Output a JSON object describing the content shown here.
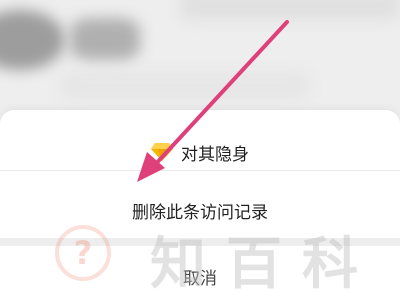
{
  "menu": {
    "hide_label": "对其隐身",
    "hide_icon": "diamond-icon",
    "delete_label": "删除此条访问记录",
    "cancel_label": "取消"
  },
  "watermark": {
    "text": "知百科",
    "logo_icon": "question-bubble-icon"
  },
  "annotation": {
    "arrow_color": "#e0407a"
  }
}
